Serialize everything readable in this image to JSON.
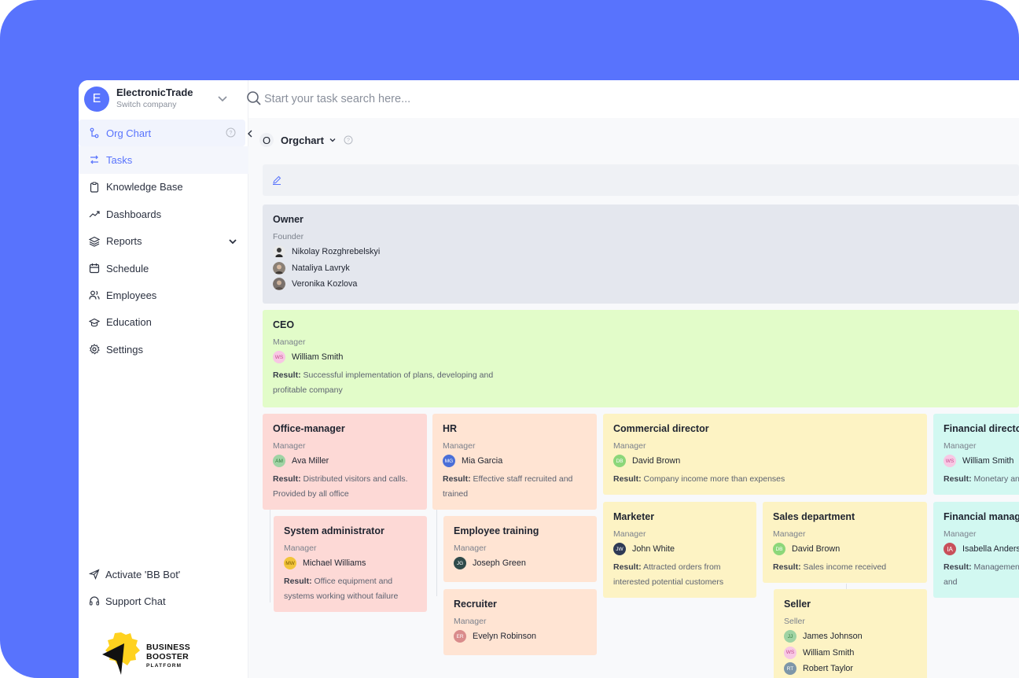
{
  "company": {
    "initial": "E",
    "name": "ElectronicTrade",
    "subtitle": "Switch company"
  },
  "search": {
    "placeholder": "Start your task search here..."
  },
  "nav": [
    {
      "label": "Org Chart",
      "icon": "org-chart-icon"
    },
    {
      "label": "Tasks",
      "icon": "tasks-arrows-icon"
    },
    {
      "label": "Knowledge Base",
      "icon": "clipboard-icon"
    },
    {
      "label": "Dashboards",
      "icon": "trend-icon"
    },
    {
      "label": "Reports",
      "icon": "layers-icon"
    },
    {
      "label": "Schedule",
      "icon": "calendar-icon"
    },
    {
      "label": "Employees",
      "icon": "users-icon"
    },
    {
      "label": "Education",
      "icon": "graduation-cap-icon"
    },
    {
      "label": "Settings",
      "icon": "gear-icon"
    }
  ],
  "bottom_nav": [
    {
      "label": "Activate 'BB Bot'",
      "icon": "send-icon"
    },
    {
      "label": "Support Chat",
      "icon": "headphones-icon"
    }
  ],
  "logo": {
    "line1": "BUSINESS",
    "line2": "BOOSTER",
    "line3": "PLATFORM"
  },
  "page": {
    "badge": "O",
    "title": "Orgchart"
  },
  "cards": {
    "owner": {
      "title": "Owner",
      "role": "Founder",
      "people": [
        "Nikolay Rozghrebelskyi",
        "Nataliya Lavryk",
        "Veronika Kozlova"
      ]
    },
    "ceo": {
      "title": "CEO",
      "role": "Manager",
      "person": {
        "initials": "WS",
        "name": "William Smith"
      },
      "result_label": "Result:",
      "result": "Successful implementation of plans, developing and profitable company"
    },
    "office_manager": {
      "title": "Office-manager",
      "role": "Manager",
      "person": {
        "initials": "AM",
        "name": "Ava Miller"
      },
      "result_label": "Result:",
      "result": "Distributed visitors and calls. Provided by all office"
    },
    "hr": {
      "title": "HR",
      "role": "Manager",
      "person": {
        "initials": "MG",
        "name": "Mia Garcia"
      },
      "result_label": "Result:",
      "result": "Effective staff recruited and trained"
    },
    "commercial": {
      "title": "Commercial director",
      "role": "Manager",
      "person": {
        "initials": "DB",
        "name": "David Brown"
      },
      "result_label": "Result:",
      "result": "Company income more than expenses"
    },
    "financial_director": {
      "title": "Financial director",
      "role": "Manager",
      "person": {
        "initials": "WS",
        "name": "William Smith"
      },
      "result_label": "Result:",
      "result": "Monetary and"
    },
    "sysadmin": {
      "title": "System administrator",
      "role": "Manager",
      "person": {
        "initials": "MW",
        "name": "Michael Williams"
      },
      "result_label": "Result:",
      "result": "Office equipment and systems working without failure"
    },
    "training": {
      "title": "Employee training",
      "role": "Manager",
      "person": {
        "initials": "JG",
        "name": "Joseph Green"
      }
    },
    "recruiter": {
      "title": "Recruiter",
      "role": "Manager",
      "person": {
        "initials": "ER",
        "name": "Evelyn Robinson"
      }
    },
    "marketer": {
      "title": "Marketer",
      "role": "Manager",
      "person": {
        "initials": "JW",
        "name": "John White"
      },
      "result_label": "Result:",
      "result": "Attracted orders from interested potential customers"
    },
    "sales": {
      "title": "Sales department",
      "role": "Manager",
      "person": {
        "initials": "DB",
        "name": "David Brown"
      },
      "result_label": "Result:",
      "result": "Sales income received"
    },
    "financial_manager": {
      "title": "Financial manager",
      "role": "Manager",
      "person": {
        "initials": "IA",
        "name": "Isabella Anderson"
      },
      "result_label": "Result:",
      "result": "Management prepared correctly and"
    },
    "seller": {
      "title": "Seller",
      "role": "Seller",
      "people": [
        {
          "initials": "JJ",
          "name": "James Johnson"
        },
        {
          "initials": "WS",
          "name": "William Smith"
        },
        {
          "initials": "RT",
          "name": "Robert Taylor"
        }
      ]
    }
  },
  "colors": {
    "accent": "#5873fd",
    "owner": "#e4e7ee",
    "ceo": "#e2fcc9",
    "office": "#fdd9d6",
    "hr": "#ffe4d3",
    "commercial": "#fdf3c4",
    "financial": "#d2f8f1"
  }
}
